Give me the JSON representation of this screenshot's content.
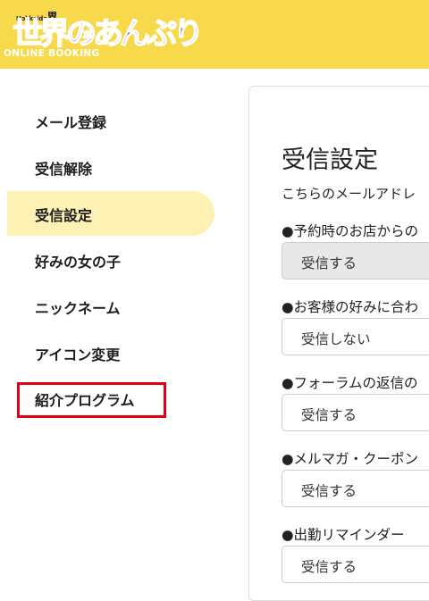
{
  "header": {
    "logo_top": "Hokkaido",
    "logo_kai": "界",
    "logo_main": "世界のあんぷり",
    "logo_tei": "亭",
    "logo_subtitle": "ONLINE BOOKING",
    "bg_color": "#f8d94c"
  },
  "sidebar": {
    "items": [
      {
        "label": "メール登録"
      },
      {
        "label": "受信解除"
      },
      {
        "label": "受信設定",
        "active": true
      },
      {
        "label": "好みの女の子"
      },
      {
        "label": "ニックネーム"
      },
      {
        "label": "アイコン変更"
      },
      {
        "label": "紹介プログラム",
        "highlighted": true
      }
    ],
    "active_color": "#fdf1b4",
    "highlight_color": "#e40012"
  },
  "main": {
    "title": "受信設定",
    "description": "こちらのメールアドレ",
    "settings": [
      {
        "label": "●予約時のお店からの",
        "value": "受信する",
        "disabled": true
      },
      {
        "label": "●お客様の好みに合わ",
        "value": "受信しない"
      },
      {
        "label": "●フォーラムの返信の",
        "value": "受信する"
      },
      {
        "label": "●メルマガ・クーポン",
        "value": "受信する"
      },
      {
        "label": "●出勤リマインダー",
        "value": "受信する"
      }
    ]
  }
}
